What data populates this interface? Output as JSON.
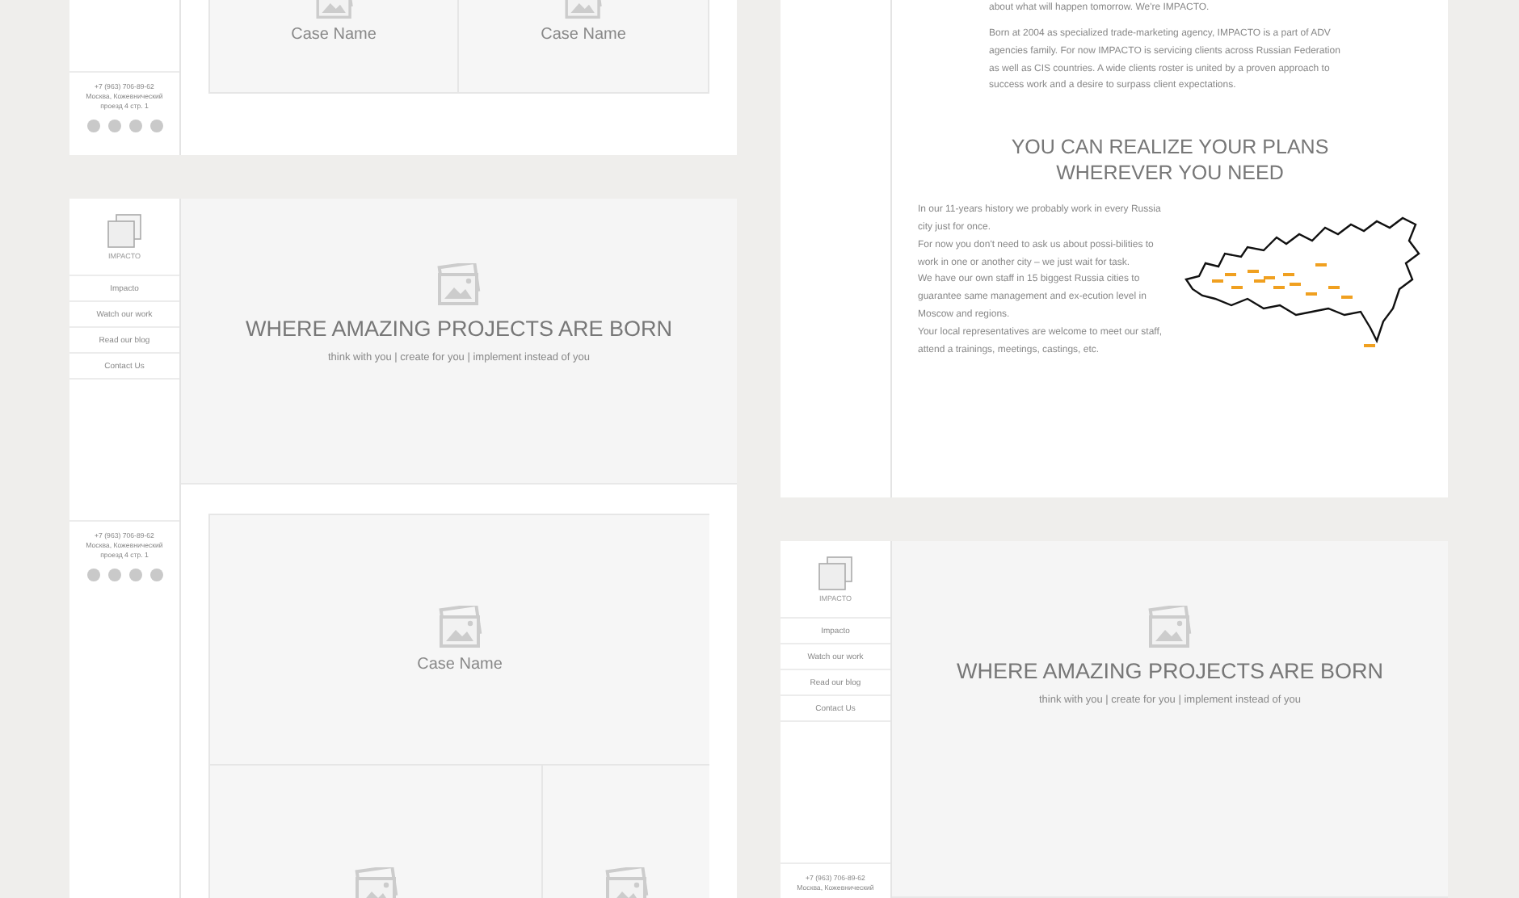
{
  "mockups": [
    {
      "kind": "cases",
      "contact": {
        "phone": "+7 (963) 706-89-62",
        "address": [
          "Москва, Кожевнический",
          "проезд 4 стр. 1"
        ]
      },
      "cases": [
        {
          "kind": "half",
          "name": "Case Name"
        },
        {
          "kind": "half",
          "name": "Case Name"
        }
      ]
    },
    {
      "kind": "home",
      "logo_text": "IMPACTO",
      "menu": [
        "Impacto",
        "Watch our work",
        "Read our blog",
        "Contact Us"
      ],
      "hero": {
        "title": "WHERE AMAZING PROJECTS ARE BORN",
        "subtitle": "think with you | create for you | implement instead of you"
      },
      "contact": {
        "phone": "+7 (963) 706-89-62",
        "address": [
          "Москва, Кожевнический",
          "проезд 4 стр. 1"
        ]
      },
      "cases": [
        {
          "kind": "wide",
          "name": "Case Name"
        },
        {
          "kind": "medium"
        },
        {
          "kind": "small"
        }
      ]
    },
    {
      "kind": "about",
      "lead": "about what will happen tomorrow. We're IMPACTO.",
      "paragraph": "Born at 2004 as specialized trade-marketing agency, IMPACTO is a part of ADV agencies family. For now IMPACTO is servicing clients across Russian Federation as well as CIS countries. A wide clients roster is united by a proven approach to success work and a desire to surpass client expectations.",
      "heading": "YOU CAN REALIZE YOUR PLANS WHEREVER YOU NEED",
      "body": [
        "In our 11-years history we probably work in every Russia city just for once.",
        "For now you don't need to ask us about possi-bilities to work in one or another city – we just wait for task.",
        "We have our own staff in 15 biggest Russia cities to guarantee same management and ex-ecution level in Moscow and regions.",
        "Your local representatives are welcome to meet our staff, attend a trainings, meetings, castings, etc."
      ]
    },
    {
      "kind": "home",
      "logo_text": "IMPACTO",
      "menu": [
        "Impacto",
        "Watch our work",
        "Read our blog",
        "Contact Us"
      ],
      "hero": {
        "title": "WHERE AMAZING PROJECTS ARE BORN",
        "subtitle": "think with you | create for you | implement instead of you"
      },
      "contact": {
        "phone": "+7 (963) 706-89-62",
        "address": [
          "Москва, Кожевнический"
        ]
      }
    }
  ]
}
